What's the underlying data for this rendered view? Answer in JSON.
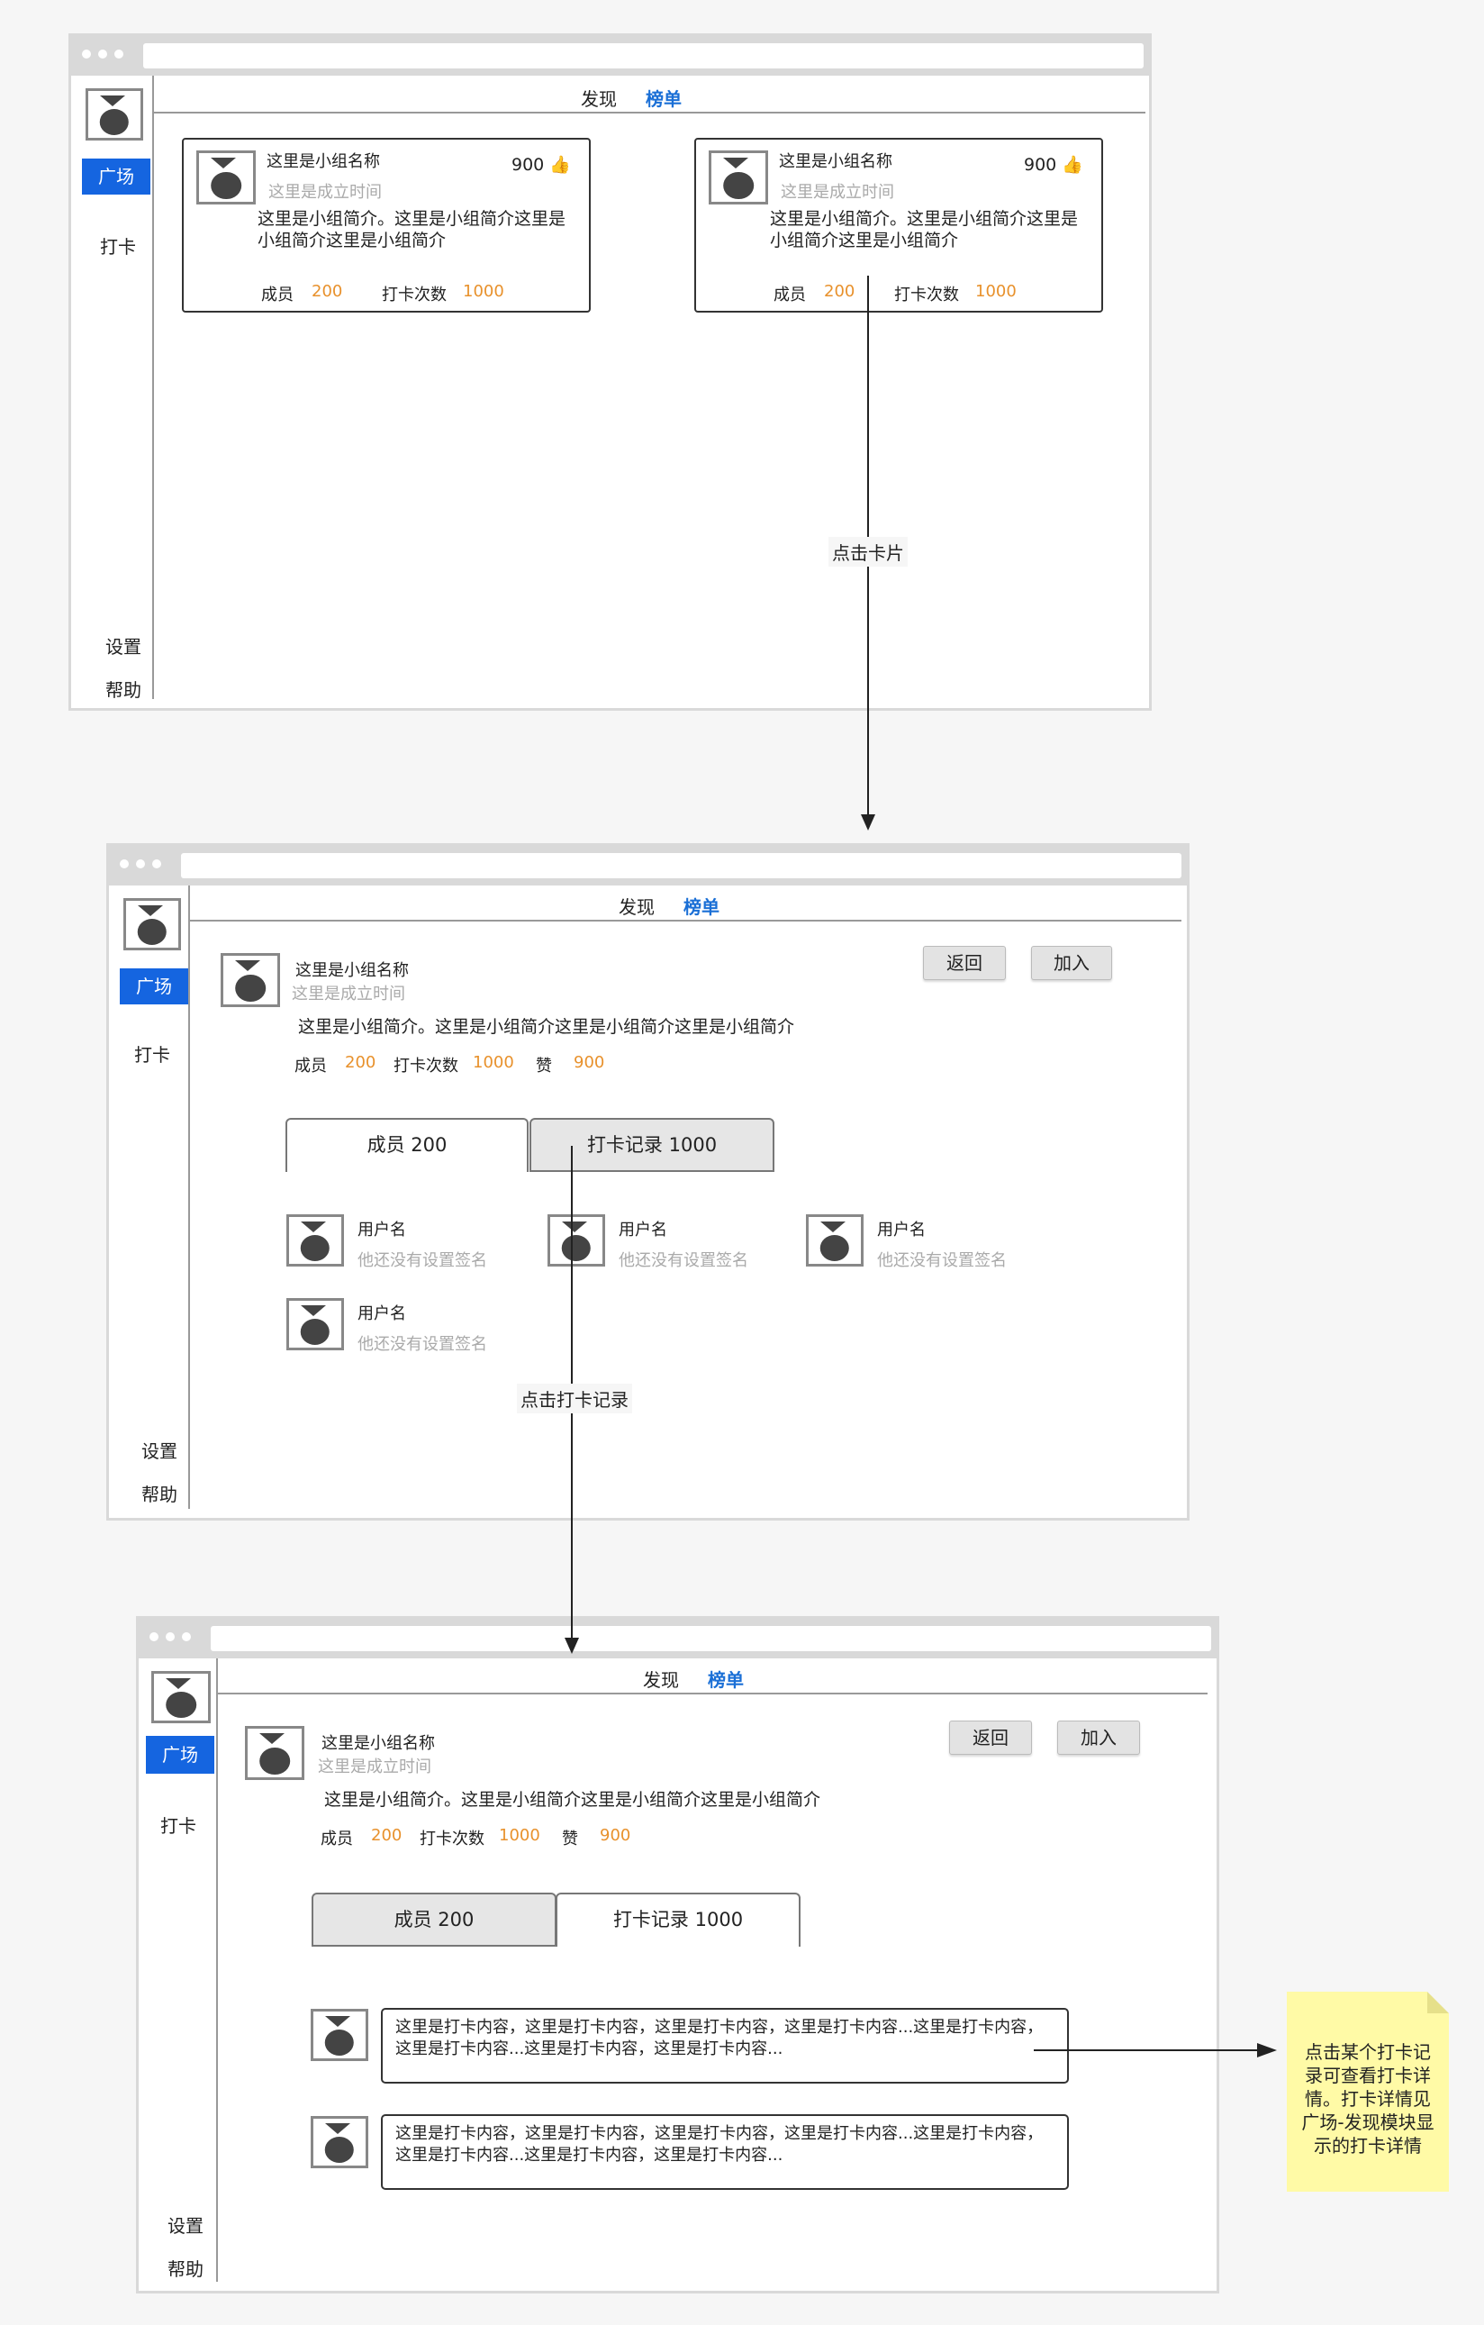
{
  "nav": {
    "logo": "logo",
    "square": "广场",
    "checkin": "打卡",
    "settings": "设置",
    "help": "帮助"
  },
  "top_tabs": {
    "discover": "发现",
    "rank": "榜单"
  },
  "group": {
    "name": "这里是小组名称",
    "founded": "这里是成立时间",
    "likes": "900",
    "intro_card": "这里是小组简介。这里是小组简介这里是小组简介这里是小组简介",
    "intro_full": "这里是小组简介。这里是小组简介这里是小组简介这里是小组简介",
    "members_label": "成员",
    "members": "200",
    "checkins_label": "打卡次数",
    "checkins": "1000",
    "likes_label": "赞"
  },
  "buttons": {
    "back": "返回",
    "join": "加入"
  },
  "panel_tabs": {
    "members": "成员 200",
    "records": "打卡记录 1000"
  },
  "member": {
    "name": "用户名",
    "signature": "他还没有设置签名"
  },
  "record": {
    "content": "这里是打卡内容，这里是打卡内容，这里是打卡内容，这里是打卡内容...这里是打卡内容，这里是打卡内容...这里是打卡内容，这里是打卡内容..."
  },
  "annotations": {
    "click_card": "点击卡片",
    "click_records": "点击打卡记录",
    "note": "点击某个打卡记录可查看打卡详情。打卡详情见广场-发现模块显示的打卡详情"
  },
  "colors": {
    "accent": "#1565e0",
    "number": "#e8912c",
    "note": "#fffaa6"
  }
}
